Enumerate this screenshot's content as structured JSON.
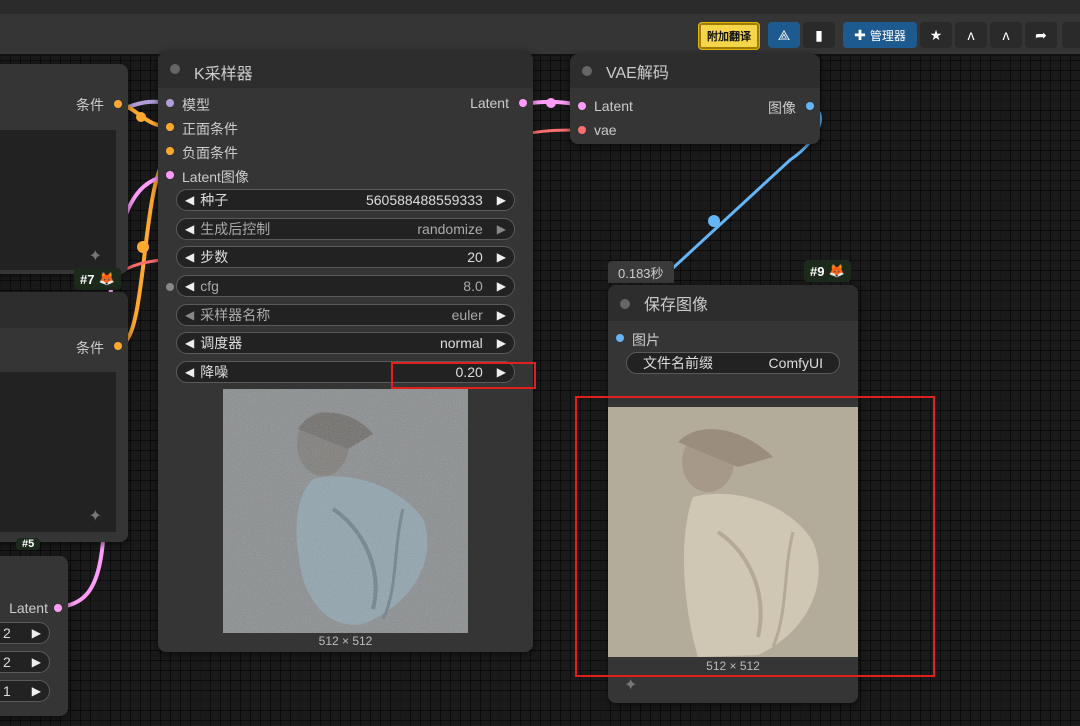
{
  "toolbar": {
    "translate_label": "附加翻译",
    "manager_label": "管理器",
    "icons": [
      "node-icon",
      "bookmark-icon",
      "puzzle-icon",
      "star-icon",
      "comfy-icon",
      "comfy-icon",
      "share-icon"
    ]
  },
  "left_node_top": {
    "output_label": "条件",
    "badge": "#7"
  },
  "left_node_mid": {
    "output_label": "条件"
  },
  "left_node_bottom": {
    "badge": "#5",
    "output_label": "Latent",
    "values": [
      "2",
      "2",
      "1"
    ]
  },
  "ksampler": {
    "title": "K采样器",
    "inputs": [
      "模型",
      "正面条件",
      "负面条件",
      "Latent图像"
    ],
    "output": "Latent",
    "cfg_input": "cfg",
    "widgets": [
      {
        "label": "种子",
        "value": "560588488559333"
      },
      {
        "label": "生成后控制",
        "value": "randomize"
      },
      {
        "label": "步数",
        "value": "20"
      },
      {
        "label": "cfg",
        "value": "8.0"
      },
      {
        "label": "采样器名称",
        "value": "euler"
      },
      {
        "label": "调度器",
        "value": "normal"
      },
      {
        "label": "降噪",
        "value": "0.20"
      }
    ],
    "preview_size": "512 × 512"
  },
  "vae_decode": {
    "title": "VAE解码",
    "inputs": [
      "Latent",
      "vae"
    ],
    "output": "图像"
  },
  "save_image": {
    "badge": "#9",
    "time": "0.183秒",
    "title": "保存图像",
    "input": "图片",
    "widget_label": "文件名前缀",
    "widget_value": "ComfyUI",
    "image_size": "512 × 512"
  },
  "colors": {
    "model": "#b39ddb",
    "conditioning": "#ffa931",
    "latent": "#ff9cf9",
    "vae": "#ff6e6e",
    "image": "#64b5f6",
    "highlight": "#e0201a"
  }
}
